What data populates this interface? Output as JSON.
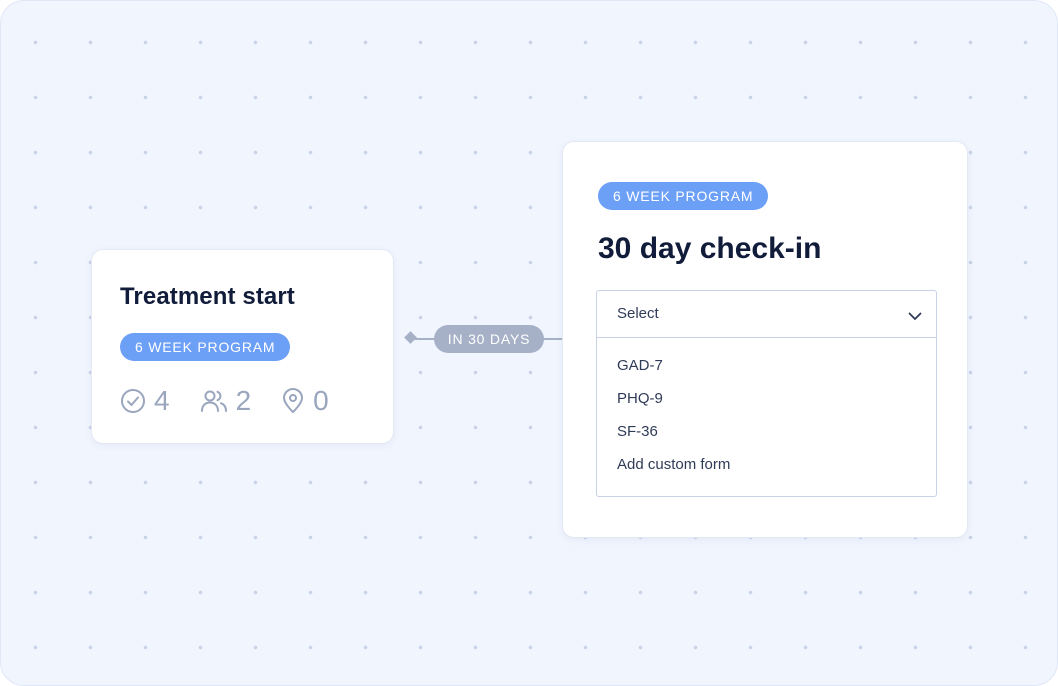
{
  "left_card": {
    "title": "Treatment start",
    "badge": "6 WEEK PROGRAM",
    "stats": {
      "tasks": {
        "icon": "check-circle-icon",
        "value": "4"
      },
      "people": {
        "icon": "users-icon",
        "value": "2"
      },
      "locations": {
        "icon": "map-pin-icon",
        "value": "0"
      }
    }
  },
  "connector": {
    "label": "IN 30 DAYS"
  },
  "right_card": {
    "badge": "6 WEEK PROGRAM",
    "title": "30 day check-in",
    "select": {
      "value": "Select",
      "icon": "chevron-down-icon",
      "options": [
        "GAD-7",
        "PHQ-9",
        "SF-36",
        "Add custom form"
      ]
    }
  },
  "colors": {
    "background": "#f1f5fe",
    "dot": "#c9d3e8",
    "badge": "#6c9ff6",
    "connector": "#a6b1c8",
    "title": "#111c3a",
    "muted": "#9aa6bd"
  }
}
